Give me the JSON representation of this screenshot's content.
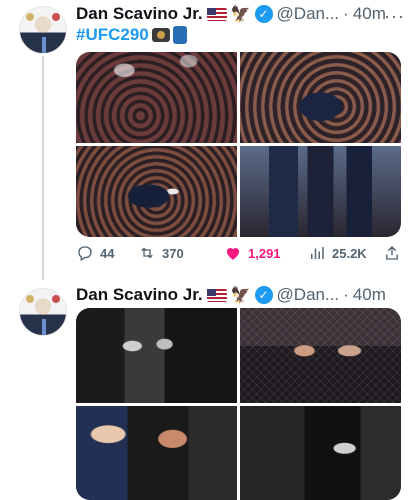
{
  "tweets": [
    {
      "author": {
        "name": "Dan Scavino Jr.",
        "handle": "@Dan...",
        "time": "40m",
        "separator": "·"
      },
      "text": "#UFC290",
      "icons": [
        "flag-us-icon",
        "eagle-icon",
        "verified-badge-icon",
        "more-options-icon",
        "camera-emoji-icon",
        "spool-emoji-icon"
      ],
      "media": [
        "crowd-photo",
        "crowd-photo",
        "crowd-photo",
        "walkout-photo"
      ],
      "stats": {
        "replies": "44",
        "retweets": "370",
        "likes": "1,291",
        "views": "25.2K"
      }
    },
    {
      "author": {
        "name": "Dan Scavino Jr.",
        "handle": "@Dan...",
        "time": "40m",
        "separator": "·"
      },
      "media": [
        "bw-photo",
        "cage-photo",
        "color-photo",
        "bw-photo"
      ]
    }
  ],
  "colors": {
    "link": "#1d9bf0",
    "like": "#f91880",
    "muted": "#536471",
    "text": "#0f1419"
  }
}
